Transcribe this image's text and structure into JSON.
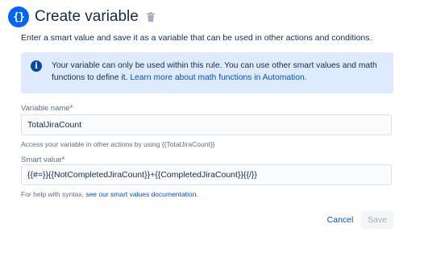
{
  "dialog": {
    "title": "Create variable",
    "icon": "curly-braces-icon",
    "delete_icon": "trash-icon",
    "intro": "Enter a smart value and save it as a variable that can be used in other actions and conditions."
  },
  "info_panel": {
    "icon": "info-icon",
    "text": "Your variable can only be used within this rule. You can use other smart values and math functions to define it. ",
    "link": "Learn more about math functions in Automation."
  },
  "variable_name": {
    "label": "Variable name",
    "required_mark": "*",
    "value": "TotalJiraCount",
    "helper": "Access your variable in other actions by using {{TotalJiraCount}}"
  },
  "smart_value": {
    "label": "Smart value",
    "required_mark": "*",
    "value": "{{#=}}{{NotCompletedJiraCount}}+{{CompletedJiraCount}}{{/}}",
    "helper_prefix": "For help with syntax, ",
    "helper_link": "see our smart values documentation",
    "helper_suffix": "."
  },
  "actions": {
    "cancel": "Cancel",
    "save": "Save"
  },
  "colors": {
    "accent": "#0065ff",
    "info_bg": "#deebff",
    "link": "#0052cc",
    "required": "#de350b"
  }
}
